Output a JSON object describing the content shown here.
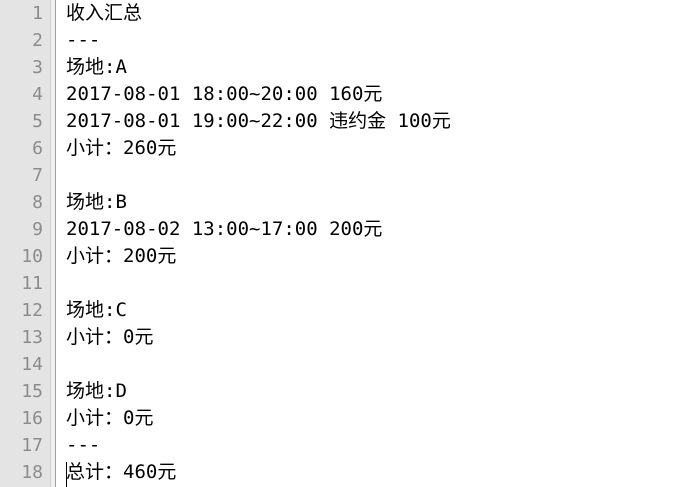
{
  "editor": {
    "line_numbers": [
      "1",
      "2",
      "3",
      "4",
      "5",
      "6",
      "7",
      "8",
      "9",
      "10",
      "11",
      "12",
      "13",
      "14",
      "15",
      "16",
      "17",
      "18"
    ],
    "lines": [
      "收入汇总",
      "---",
      "场地:A",
      "2017-08-01 18:00~20:00 160元",
      "2017-08-01 19:00~22:00 违约金 100元",
      "小计：260元",
      "",
      "场地:B",
      "2017-08-02 13:00~17:00 200元",
      "小计：200元",
      "",
      "场地:C",
      "小计：0元",
      "",
      "场地:D",
      "小计：0元",
      "---",
      "总计：460元"
    ]
  }
}
